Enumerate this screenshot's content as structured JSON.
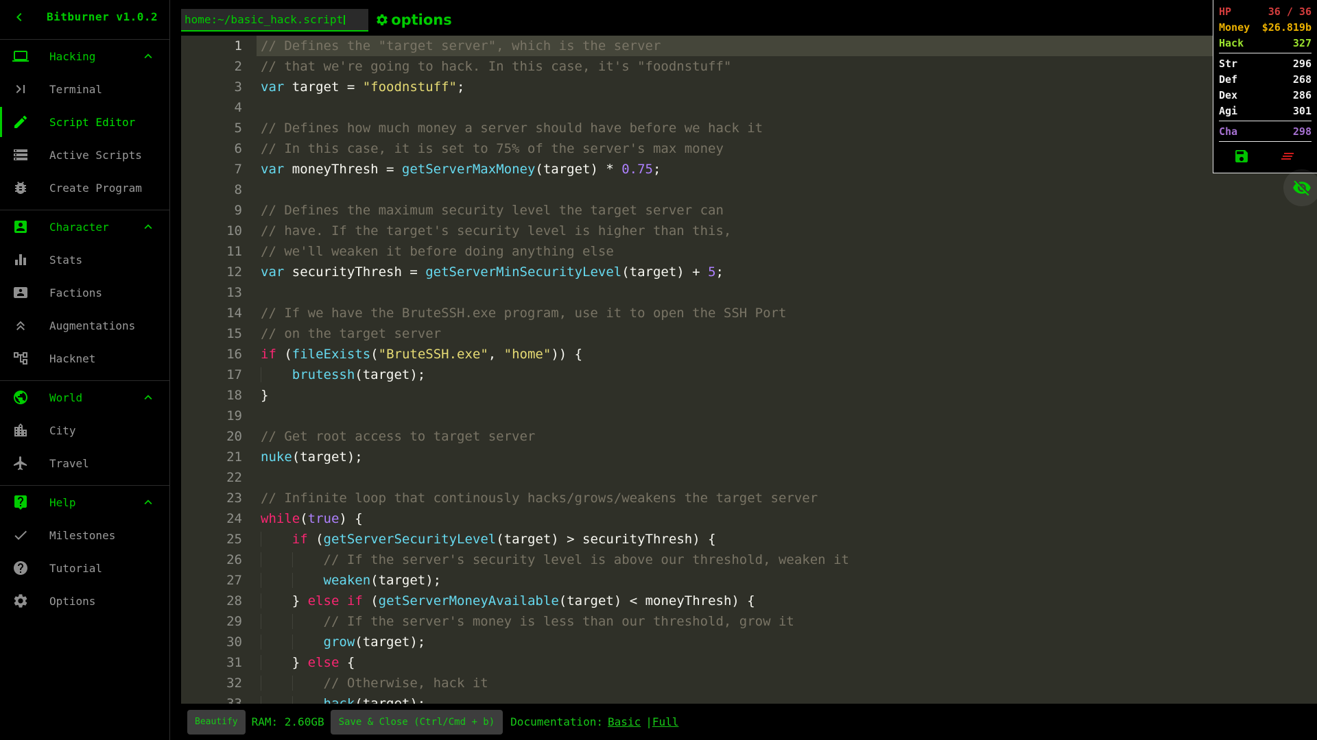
{
  "app": {
    "title": "Bitburner v1.0.2"
  },
  "sidebar": {
    "sections": [
      {
        "label": "Hacking",
        "items": [
          {
            "label": "Terminal"
          },
          {
            "label": "Script Editor"
          },
          {
            "label": "Active Scripts"
          },
          {
            "label": "Create Program"
          }
        ]
      },
      {
        "label": "Character",
        "items": [
          {
            "label": "Stats"
          },
          {
            "label": "Factions"
          },
          {
            "label": "Augmentations"
          },
          {
            "label": "Hacknet"
          }
        ]
      },
      {
        "label": "World",
        "items": [
          {
            "label": "City"
          },
          {
            "label": "Travel"
          }
        ]
      },
      {
        "label": "Help",
        "items": [
          {
            "label": "Milestones"
          },
          {
            "label": "Tutorial"
          },
          {
            "label": "Options"
          }
        ]
      }
    ]
  },
  "editor": {
    "tab_label": "home:~/basic_hack.script",
    "options_label": "options",
    "active_line": 1,
    "code_lines": [
      [
        [
          "c",
          "// Defines the \"target server\", which is the server"
        ]
      ],
      [
        [
          "c",
          "// that we're going to hack. In this case, it's \"foodnstuff\""
        ]
      ],
      [
        [
          "t",
          "var"
        ],
        [
          "p",
          " target = "
        ],
        [
          "s",
          "\"foodnstuff\""
        ],
        [
          "p",
          ";"
        ]
      ],
      [],
      [
        [
          "c",
          "// Defines how much money a server should have before we hack it"
        ]
      ],
      [
        [
          "c",
          "// In this case, it is set to 75% of the server's max money"
        ]
      ],
      [
        [
          "t",
          "var"
        ],
        [
          "p",
          " moneyThresh = "
        ],
        [
          "f",
          "getServerMaxMoney"
        ],
        [
          "p",
          "(target) * "
        ],
        [
          "n",
          "0.75"
        ],
        [
          "p",
          ";"
        ]
      ],
      [],
      [
        [
          "c",
          "// Defines the maximum security level the target server can"
        ]
      ],
      [
        [
          "c",
          "// have. If the target's security level is higher than this,"
        ]
      ],
      [
        [
          "c",
          "// we'll weaken it before doing anything else"
        ]
      ],
      [
        [
          "t",
          "var"
        ],
        [
          "p",
          " securityThresh = "
        ],
        [
          "f",
          "getServerMinSecurityLevel"
        ],
        [
          "p",
          "(target) + "
        ],
        [
          "n",
          "5"
        ],
        [
          "p",
          ";"
        ]
      ],
      [],
      [
        [
          "c",
          "// If we have the BruteSSH.exe program, use it to open the SSH Port"
        ]
      ],
      [
        [
          "c",
          "// on the target server"
        ]
      ],
      [
        [
          "k",
          "if"
        ],
        [
          "p",
          " ("
        ],
        [
          "f",
          "fileExists"
        ],
        [
          "p",
          "("
        ],
        [
          "s",
          "\"BruteSSH.exe\""
        ],
        [
          "p",
          ", "
        ],
        [
          "s",
          "\"home\""
        ],
        [
          "p",
          ")) {"
        ]
      ],
      [
        [
          "g",
          "    "
        ],
        [
          "f",
          "brutessh"
        ],
        [
          "p",
          "(target);"
        ]
      ],
      [
        [
          "p",
          "}"
        ]
      ],
      [],
      [
        [
          "c",
          "// Get root access to target server"
        ]
      ],
      [
        [
          "f",
          "nuke"
        ],
        [
          "p",
          "(target);"
        ]
      ],
      [],
      [
        [
          "c",
          "// Infinite loop that continously hacks/grows/weakens the target server"
        ]
      ],
      [
        [
          "k",
          "while"
        ],
        [
          "p",
          "("
        ],
        [
          "n",
          "true"
        ],
        [
          "p",
          ") {"
        ]
      ],
      [
        [
          "g",
          "    "
        ],
        [
          "k",
          "if"
        ],
        [
          "p",
          " ("
        ],
        [
          "f",
          "getServerSecurityLevel"
        ],
        [
          "p",
          "(target) > securityThresh) {"
        ]
      ],
      [
        [
          "g",
          "    "
        ],
        [
          "g",
          "    "
        ],
        [
          "c",
          "// If the server's security level is above our threshold, weaken it"
        ]
      ],
      [
        [
          "g",
          "    "
        ],
        [
          "g",
          "    "
        ],
        [
          "f",
          "weaken"
        ],
        [
          "p",
          "(target);"
        ]
      ],
      [
        [
          "g",
          "    "
        ],
        [
          "p",
          "} "
        ],
        [
          "k",
          "else"
        ],
        [
          "p",
          " "
        ],
        [
          "k",
          "if"
        ],
        [
          "p",
          " ("
        ],
        [
          "f",
          "getServerMoneyAvailable"
        ],
        [
          "p",
          "(target) < moneyThresh) {"
        ]
      ],
      [
        [
          "g",
          "    "
        ],
        [
          "g",
          "    "
        ],
        [
          "c",
          "// If the server's money is less than our threshold, grow it"
        ]
      ],
      [
        [
          "g",
          "    "
        ],
        [
          "g",
          "    "
        ],
        [
          "f",
          "grow"
        ],
        [
          "p",
          "(target);"
        ]
      ],
      [
        [
          "g",
          "    "
        ],
        [
          "p",
          "} "
        ],
        [
          "k",
          "else"
        ],
        [
          "p",
          " {"
        ]
      ],
      [
        [
          "g",
          "    "
        ],
        [
          "g",
          "    "
        ],
        [
          "c",
          "// Otherwise, hack it"
        ]
      ],
      [
        [
          "g",
          "    "
        ],
        [
          "g",
          "    "
        ],
        [
          "f",
          "hack"
        ],
        [
          "p",
          "(target);"
        ]
      ]
    ]
  },
  "statusbar": {
    "beautify_label": "Beautify",
    "ram_text": "RAM: 2.60GB",
    "save_close_label": "Save & Close (Ctrl/Cmd + b)",
    "documentation_label": "Documentation:",
    "documentation_basic": "Basic",
    "documentation_separator": "|",
    "documentation_full": "Full"
  },
  "overview": {
    "hp_label": "HP",
    "hp_value": "36 / 36",
    "money_label": "Money",
    "money_value": "$26.819b",
    "hack_label": "Hack",
    "hack_value": "327",
    "str_label": "Str",
    "str_value": "296",
    "def_label": "Def",
    "def_value": "268",
    "dex_label": "Dex",
    "dex_value": "286",
    "agi_label": "Agi",
    "agi_value": "301",
    "cha_label": "Cha",
    "cha_value": "298"
  },
  "colors": {
    "primary_green": "#00cc00",
    "hp_red": "#d43d3d",
    "money_gold": "#edb200",
    "hack_green": "#9be22e",
    "cha_purple": "#a671d1",
    "kill_red": "#cf1b1b",
    "editor_bg": "#2f3028",
    "keyword_pink": "#f92672",
    "builtin_cyan": "#66d9ef",
    "string_yellow": "#e6db74",
    "number_purple": "#ae81ff",
    "comment_olive": "#797465"
  }
}
